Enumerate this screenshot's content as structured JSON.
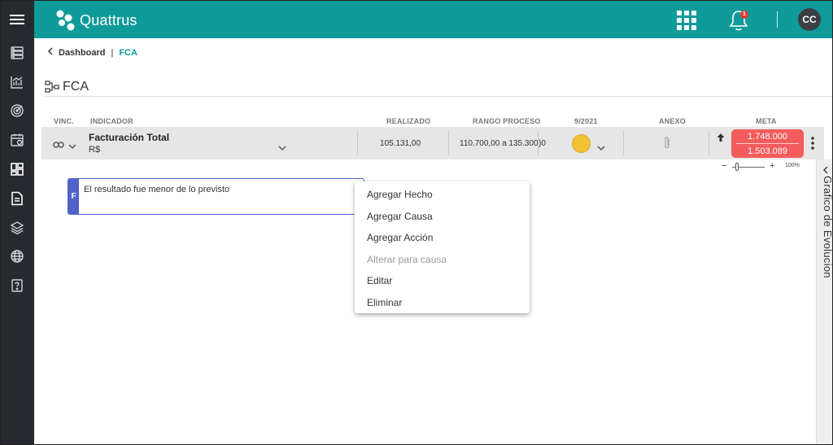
{
  "app": {
    "name": "Quattrus",
    "notification_count": "1",
    "user_initials": "CC"
  },
  "breadcrumb": {
    "back_label": "Dashboard",
    "separator": "|",
    "current": "FCA"
  },
  "page": {
    "title": "FCA"
  },
  "table": {
    "headers": {
      "vinc": "VINC.",
      "indicador": "INDICADOR",
      "realizado": "REALIZADO",
      "rango": "RANGO PROCESO",
      "period": "9/2021",
      "anexo": "ANEXO",
      "meta": "META"
    },
    "row": {
      "name": "Facturación Total",
      "unit": "R$",
      "realizado": "105.131,00",
      "rango": "110.700,00 a 135.300",
      "rango_extra": ")0",
      "status_color": "#f2c233",
      "meta_top": "1.748.000",
      "meta_bottom": "1.503.089"
    }
  },
  "zoom": {
    "minus": "−",
    "plus": "+",
    "percent": "100%",
    "level_percent": 100
  },
  "evolution_panel": {
    "label": "Grafico de Evolucion"
  },
  "fact": {
    "tag": "F",
    "text": "El resultado fue menor de lo previsto"
  },
  "context_menu": {
    "items": [
      {
        "label": "Agregar Hecho",
        "enabled": true
      },
      {
        "label": "Agregar Causa",
        "enabled": true
      },
      {
        "label": "Agregar Acción",
        "enabled": true
      },
      {
        "label": "Alterar para causa",
        "enabled": false
      },
      {
        "label": "Editar",
        "enabled": true
      },
      {
        "label": "Eliminar",
        "enabled": true
      }
    ]
  },
  "colors": {
    "topbar": "#0f9b99",
    "sidebar": "#262a2f",
    "meta": "#f25c5c",
    "fact_accent": "#4f63c9"
  }
}
